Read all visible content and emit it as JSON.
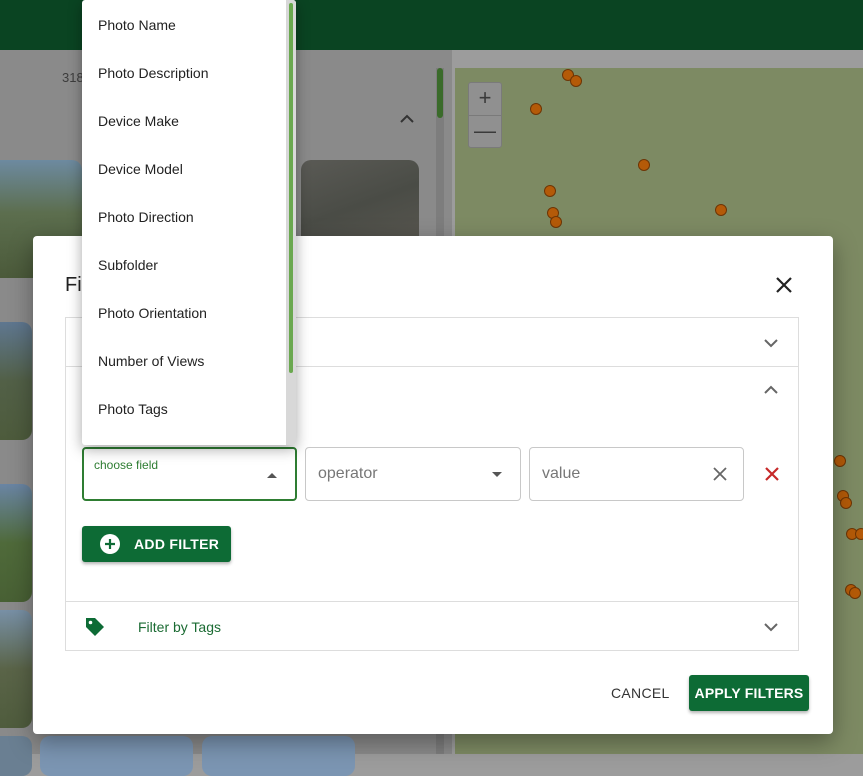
{
  "background": {
    "result_count": "318",
    "accent": "#0a4422"
  },
  "map": {
    "zoom_in": "+",
    "zoom_out": "—"
  },
  "dialog": {
    "title": "Fi",
    "rule_row": {
      "field_label": "choose field",
      "operator_placeholder": "operator",
      "value_placeholder": "value"
    },
    "add_filter_label": "ADD FILTER",
    "tags_section_label": "Filter by Tags",
    "cancel_label": "CANCEL",
    "apply_label": "APPLY FILTERS"
  },
  "dropdown": {
    "options": [
      "Photo Name",
      "Photo Description",
      "Device Make",
      "Device Model",
      "Photo Direction",
      "Subfolder",
      "Photo Orientation",
      "Number of Views",
      "Photo Tags"
    ]
  },
  "colors": {
    "primary": "#0d6b35",
    "danger": "#c62828",
    "pin": "#b45a08"
  }
}
